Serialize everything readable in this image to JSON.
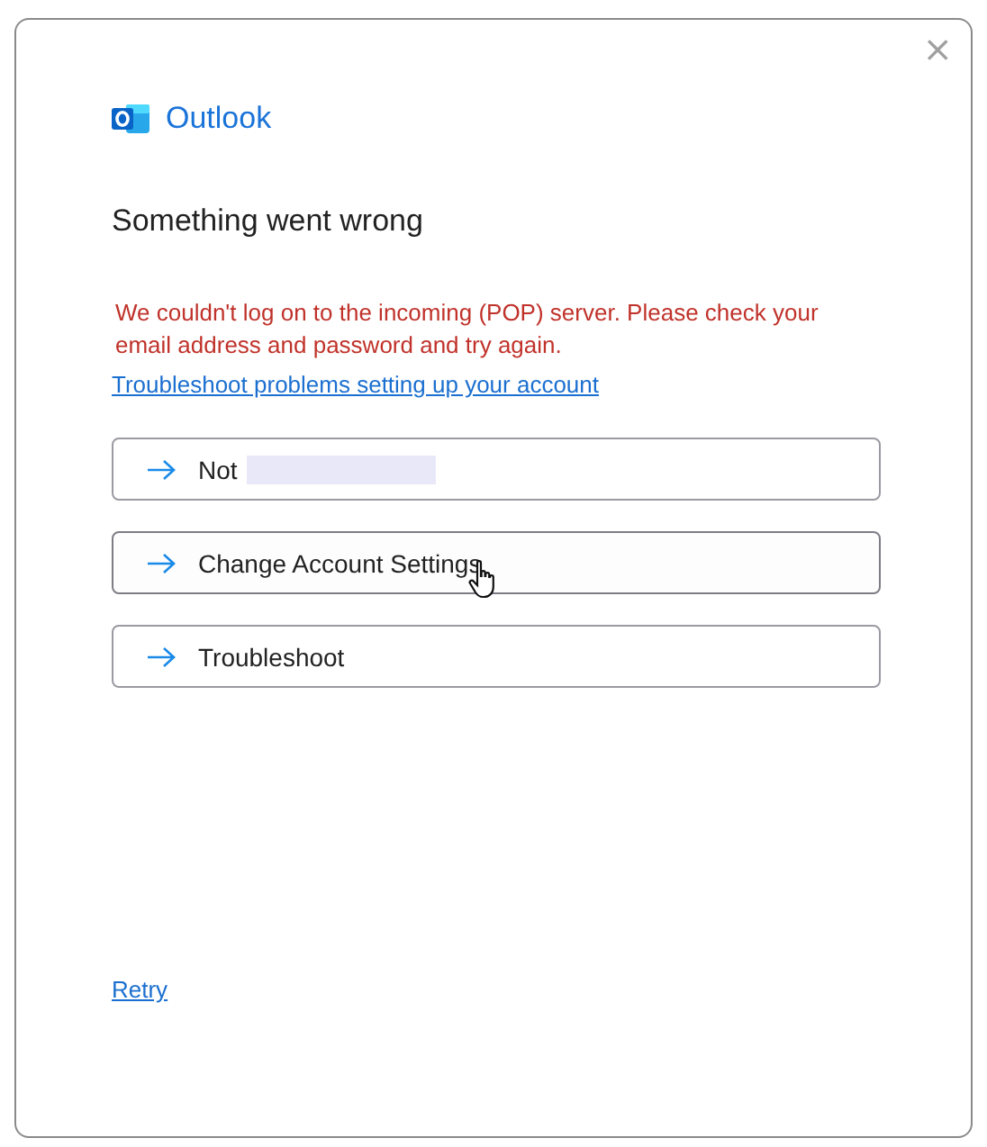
{
  "window": {
    "close": "×"
  },
  "brand": {
    "name": "Outlook"
  },
  "heading": "Something went wrong",
  "error": "We couldn't log on to the incoming (POP) server. Please check your email address and password and try again.",
  "help_link": "Troubleshoot problems setting up your account",
  "actions": [
    {
      "label": "Not",
      "redacted": true,
      "hovered": false
    },
    {
      "label": "Change Account Settings",
      "redacted": false,
      "hovered": true
    },
    {
      "label": "Troubleshoot",
      "redacted": false,
      "hovered": false
    }
  ],
  "retry_link": "Retry"
}
